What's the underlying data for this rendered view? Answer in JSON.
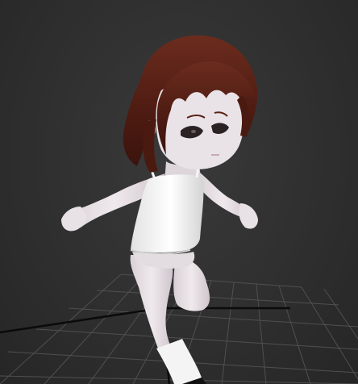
{
  "viewport": {
    "background_color": "#2f2f2f",
    "grid_color": "#505050",
    "grid_highlight_color": "#0b0b0b",
    "character": {
      "hair_color": "#5a2217",
      "skin_color": "#e6dfe3",
      "dress_color": "#f2f2f2",
      "sock_color": "#f4f4f4"
    }
  }
}
